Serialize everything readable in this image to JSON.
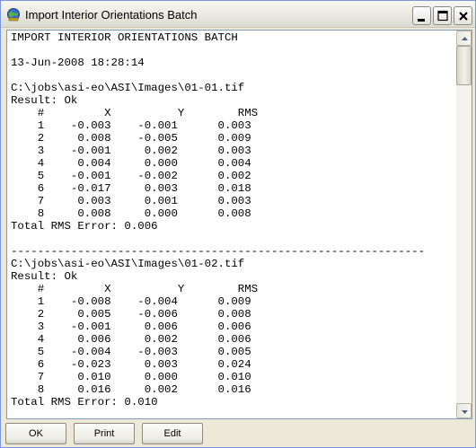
{
  "window": {
    "title": "Import Interior Orientations Batch",
    "icon": "app-globe-icon"
  },
  "titlebar_buttons": [
    "minimize-icon",
    "maximize-icon",
    "close-icon"
  ],
  "report": {
    "lines": [
      "IMPORT INTERIOR ORIENTATIONS BATCH",
      "",
      "13-Jun-2008 18:28:14",
      "",
      "C:\\jobs\\asi-eo\\ASI\\Images\\01-01.tif",
      "Result: Ok",
      "    #         X          Y        RMS",
      "    1    -0.003    -0.001      0.003",
      "    2     0.008    -0.005      0.009",
      "    3    -0.001     0.002      0.003",
      "    4     0.004     0.000      0.004",
      "    5    -0.001    -0.002      0.002",
      "    6    -0.017     0.003      0.018",
      "    7     0.003     0.001      0.003",
      "    8     0.008     0.000      0.008",
      "Total RMS Error: 0.006",
      "",
      "--------------------------------------------------------------",
      "C:\\jobs\\asi-eo\\ASI\\Images\\01-02.tif",
      "Result: Ok",
      "    #         X          Y        RMS",
      "    1    -0.008    -0.004      0.009",
      "    2     0.005    -0.006      0.008",
      "    3    -0.001     0.006      0.006",
      "    4     0.006     0.002      0.006",
      "    5    -0.004    -0.003      0.005",
      "    6    -0.023     0.003      0.024",
      "    7     0.010     0.000      0.010",
      "    8     0.016     0.002      0.016",
      "Total RMS Error: 0.010"
    ]
  },
  "buttons": {
    "ok": "OK",
    "print": "Print",
    "edit": "Edit"
  }
}
